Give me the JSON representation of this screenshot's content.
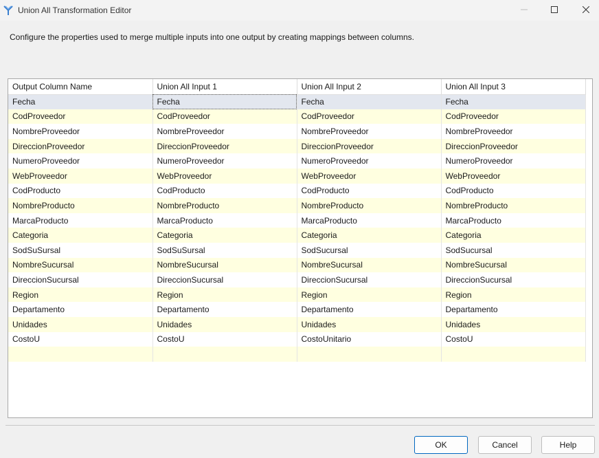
{
  "window": {
    "title": "Union All Transformation Editor",
    "icons": {
      "app": "union-all-icon",
      "minimize": "minimize-icon",
      "maximize": "maximize-icon",
      "close": "close-icon"
    }
  },
  "description": "Configure the properties used to merge multiple inputs into one output by creating mappings between columns.",
  "grid": {
    "headers": [
      "Output Column Name",
      "Union All Input 1",
      "Union All Input 2",
      "Union All Input 3"
    ],
    "rows": [
      [
        "Fecha",
        "Fecha",
        "Fecha",
        "Fecha"
      ],
      [
        "CodProveedor",
        "CodProveedor",
        "CodProveedor",
        "CodProveedor"
      ],
      [
        "NombreProveedor",
        "NombreProveedor",
        "NombreProveedor",
        "NombreProveedor"
      ],
      [
        "DireccionProveedor",
        "DireccionProveedor",
        "DireccionProveedor",
        "DireccionProveedor"
      ],
      [
        "NumeroProveedor",
        "NumeroProveedor",
        "NumeroProveedor",
        "NumeroProveedor"
      ],
      [
        "WebProveedor",
        "WebProveedor",
        "WebProveedor",
        "WebProveedor"
      ],
      [
        "CodProducto",
        "CodProducto",
        "CodProducto",
        "CodProducto"
      ],
      [
        "NombreProducto",
        "NombreProducto",
        "NombreProducto",
        "NombreProducto"
      ],
      [
        "MarcaProducto",
        "MarcaProducto",
        "MarcaProducto",
        "MarcaProducto"
      ],
      [
        "Categoria",
        "Categoria",
        "Categoria",
        "Categoria"
      ],
      [
        "SodSuSursal",
        "SodSuSursal",
        "SodSucursal",
        "SodSucursal"
      ],
      [
        "NombreSucursal",
        "NombreSucursal",
        "NombreSucursal",
        "NombreSucursal"
      ],
      [
        "DireccionSucursal",
        "DireccionSucursal",
        "DireccionSucursal",
        "DireccionSucursal"
      ],
      [
        "Region",
        "Region",
        "Region",
        "Region"
      ],
      [
        "Departamento",
        "Departamento",
        "Departamento",
        "Departamento"
      ],
      [
        "Unidades",
        "Unidades",
        "Unidades",
        "Unidades"
      ],
      [
        "CostoU",
        "CostoU",
        "CostoUnitario",
        "CostoU"
      ],
      [
        "",
        "",
        "",
        ""
      ]
    ],
    "selected_row": 0,
    "focused_column": 1,
    "colors": {
      "alt_row": "#ffffe0",
      "selected_row": "#e3e7ef"
    }
  },
  "buttons": {
    "ok": "OK",
    "cancel": "Cancel",
    "help": "Help"
  }
}
